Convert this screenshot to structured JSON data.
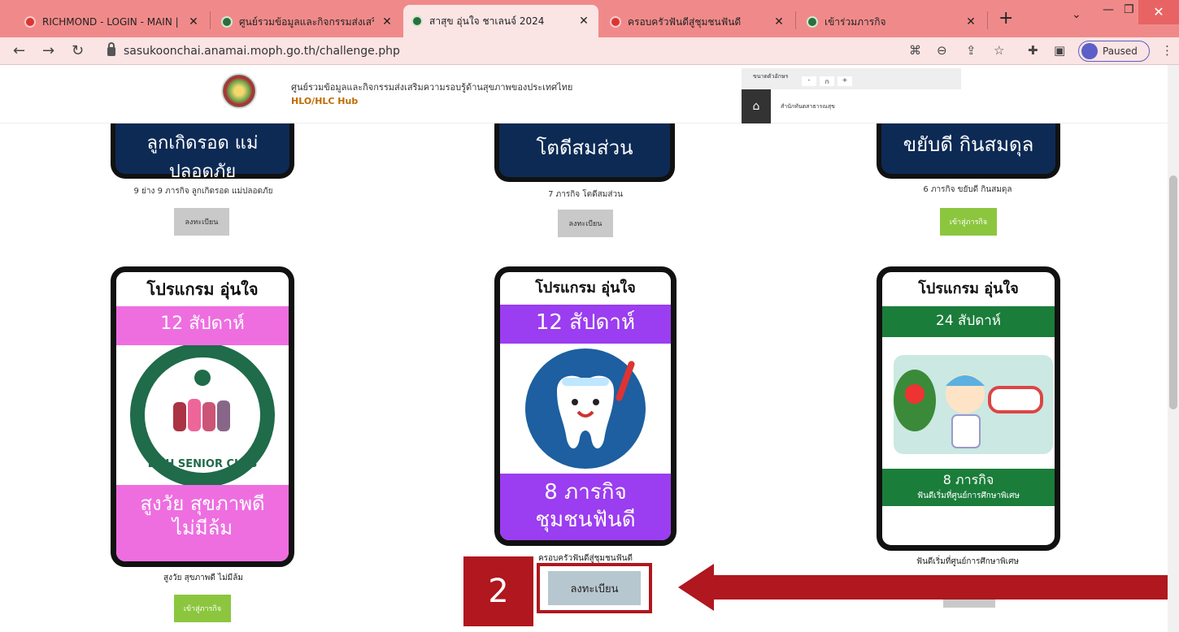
{
  "browser": {
    "tabs": [
      {
        "title": "RICHMOND - LOGIN - MAIN |",
        "active": false
      },
      {
        "title": "ศูนย์รวมข้อมูลและกิจกรรมส่งเสริม",
        "active": false
      },
      {
        "title": "สาสุข อุ่นใจ ชาเลนจ์ 2024",
        "active": true
      },
      {
        "title": "ครอบครัวฟันดีสู่ชุมชนฟันดี",
        "active": false
      },
      {
        "title": "เข้าร่วมภารกิจ",
        "active": false
      }
    ],
    "url": "sasukoonchai.anamai.moph.go.th/challenge.php",
    "profile_label": "Paused"
  },
  "header": {
    "title": "ศูนย์รวมข้อมูลและกิจกรรมส่งเสริมความรอบรู้ด้านสุขภาพของประเทศไทย",
    "subtitle": "HLO/HLC Hub",
    "font_size_label": "ขนาดตัวอักษร",
    "font_sizes": [
      "-",
      "ก",
      "+"
    ],
    "department": "สำนักทันตสาธารณสุข"
  },
  "top_cards": [
    {
      "banner": "ลูกเกิดรอด แม่ปลอดภัย",
      "caption": "9 ย่าง 9 ภารกิจ ลูกเกิดรอด แม่ปลอดภัย",
      "button": "ลงทะเบียน",
      "button_type": "grey"
    },
    {
      "banner": "โตดีสมส่วน",
      "caption": "7 ภารกิจ โตดีสมส่วน",
      "button": "ลงทะเบียน",
      "button_type": "grey"
    },
    {
      "banner": "ขยับดี กินสมดุล",
      "caption": "6 ภารกิจ ขยับดี กินสมดุล",
      "button": "เข้าสู่ภารกิจ",
      "button_type": "green"
    }
  ],
  "posters": [
    {
      "heading": "โปรแกรม อุ่นใจ",
      "band_top": "12 สัปดาห์",
      "band_bottom_1": "สูงวัย สุขภาพดี",
      "band_bottom_2": "ไม่มีล้ม",
      "caption": "สูงวัย สุขภาพดี ไม่มีล้ม",
      "button": "เข้าสู่ภารกิจ",
      "seal_text": "DOH SENIOR CLUB",
      "color": "#ee6ee0"
    },
    {
      "heading": "โปรแกรม อุ่นใจ",
      "band_top": "12 สัปดาห์",
      "band_bottom_1": "8 ภารกิจ",
      "band_bottom_2": "ชุมชนฟันดี",
      "caption": "ครอบครัวฟันดีสู่ชุมชนฟันดี",
      "button": "ลงทะเบียน",
      "color": "#9b3df0"
    },
    {
      "heading": "โปรแกรม อุ่นใจ",
      "band_top": "24 สัปดาห์",
      "band_bottom_1": "8 ภารกิจ",
      "band_bottom_2": "ฟันดีเริ่มที่ศูนย์การศึกษาพิเศษ",
      "caption": "ฟันดีเริ่มที่ศูนย์การศึกษาพิเศษ",
      "color": "#1b7d3a"
    }
  ],
  "annotation": {
    "step_number": "2",
    "accent": "#b0171e"
  }
}
